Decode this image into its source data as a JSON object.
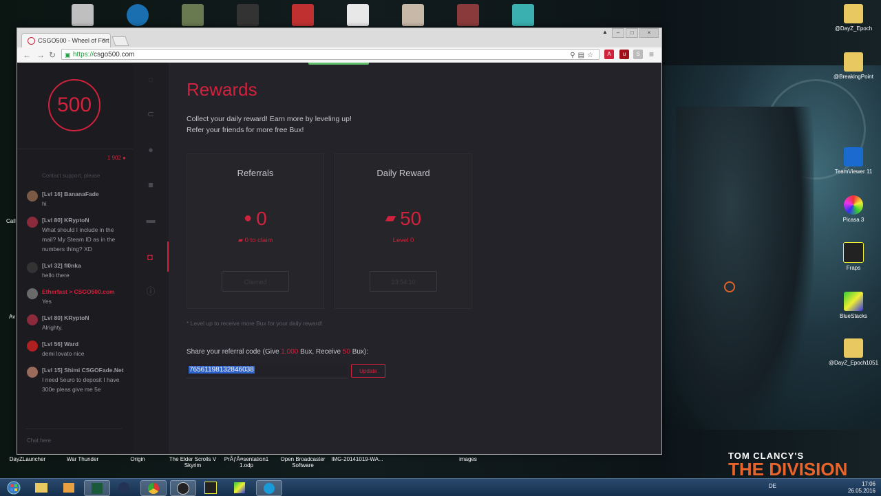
{
  "desktop": {
    "right_icons": [
      {
        "label": "@DayZ_Epoch",
        "icon": "folder-icon"
      },
      {
        "label": "@BreakingPoint",
        "icon": "folder-icon"
      },
      {
        "label": "TeamViewer 11",
        "icon": "teamviewer-icon"
      },
      {
        "label": "Picasa 3",
        "icon": "picasa-icon"
      },
      {
        "label": "Fraps",
        "icon": "fraps-icon"
      },
      {
        "label": "BlueStacks",
        "icon": "bluestacks-icon"
      },
      {
        "label": "@DayZ_Epoch1051",
        "icon": "folder-icon"
      }
    ],
    "bottom_icons": [
      {
        "label": "DayZLauncher"
      },
      {
        "label": "War Thunder"
      },
      {
        "label": "Origin"
      },
      {
        "label": "The Elder Scrolls V Skyrim"
      },
      {
        "label": "PrÃƒÂ¤sentation1 1.odp"
      },
      {
        "label": "Open Broadcaster Software"
      },
      {
        "label": "IMG-20141019-WA..."
      },
      {
        "label": "images"
      }
    ],
    "left_clipped": [
      "Call",
      "Av"
    ],
    "division_logo": {
      "line1": "TOM CLANCY'S",
      "line2": "THE DIVISION"
    }
  },
  "taskbar": {
    "lang": "DE",
    "time": "17:06",
    "date": "26.05.2016"
  },
  "browser": {
    "tab_title": "CSGO500 - Wheel of Fort",
    "url_scheme": "https://",
    "url_host": "csgo500.com"
  },
  "site": {
    "logo": "500",
    "online_count": "1 902",
    "chat_info": "Contact support, please",
    "chat": [
      {
        "name": "[Lvl 16] BananaFade",
        "text": "hi",
        "mod": false,
        "avatar": "#7a5a44"
      },
      {
        "name": "[Lvl 80] KRyptoN",
        "text": "What should I include in the mail? My Steam ID as in the numbers thing? XD",
        "mod": false,
        "avatar": "#8a2a3a"
      },
      {
        "name": "[Lvl 32] fl0nka",
        "text": "hello there",
        "mod": false,
        "avatar": "#333"
      },
      {
        "name": "Etherfast > CSGO500.com",
        "text": "Yes",
        "mod": true,
        "avatar": "#6a6a6a"
      },
      {
        "name": "[Lvl 80] KRyptoN",
        "text": "Alrighty.",
        "mod": false,
        "avatar": "#8a2a3a"
      },
      {
        "name": "[Lvl 56] Ward",
        "text": "demi lovato nice",
        "mod": false,
        "avatar": "#b02020"
      },
      {
        "name": "[Lvl 15] Shimi CSGOFade.Net",
        "text": "I need 5euro to deposit I have 300e pleas give me 5e",
        "mod": false,
        "avatar": "#9a6a5a"
      }
    ],
    "chat_placeholder": "Chat here",
    "rewards": {
      "title": "Rewards",
      "desc1": "Collect your daily reward! Earn more by leveling up!",
      "desc2": "Refer your friends for more free Bux!",
      "referrals": {
        "title": "Referrals",
        "value": "0",
        "sub": "0 to claim",
        "button": "Claimed"
      },
      "daily": {
        "title": "Daily Reward",
        "value": "50",
        "sub": "Level 0",
        "button": "23:54:10"
      },
      "note": "* Level up to receive more Bux for your daily reward!",
      "share_prefix": "Share your referral code (Give ",
      "share_give": "1,000",
      "share_mid": " Bux, Receive ",
      "share_receive": "50",
      "share_suffix": " Bux):",
      "code": "76561198132846038",
      "update": "Update"
    }
  }
}
